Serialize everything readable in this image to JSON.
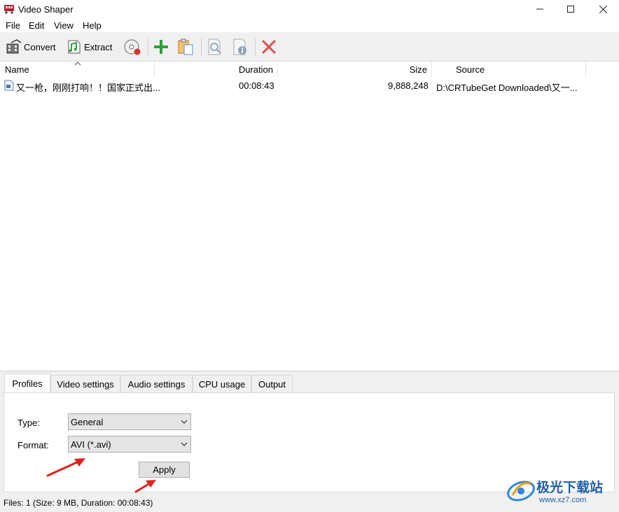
{
  "window": {
    "title": "Video Shaper",
    "minimize_icon": "minimize-icon",
    "maximize_icon": "maximize-icon",
    "close_icon": "close-icon"
  },
  "menu": [
    "File",
    "Edit",
    "View",
    "Help"
  ],
  "toolbar": {
    "convert_label": "Convert",
    "extract_label": "Extract"
  },
  "list": {
    "columns": {
      "name": "Name",
      "duration": "Duration",
      "size": "Size",
      "source": "Source"
    },
    "rows": [
      {
        "name": "又一枪，刚刚打响！！国家正式出...",
        "duration": "00:08:43",
        "size": "9,888,248",
        "source": "D:\\CRTubeGet Downloaded\\又一..."
      }
    ]
  },
  "tabs": [
    "Profiles",
    "Video settings",
    "Audio settings",
    "CPU usage",
    "Output"
  ],
  "profiles": {
    "type_label": "Type:",
    "type_value": "General",
    "format_label": "Format:",
    "format_value": "AVI (*.avi)",
    "apply_label": "Apply"
  },
  "status": {
    "text": "Files: 1 (Size: 9 MB, Duration: 00:08:43)"
  },
  "watermark": {
    "brand": "极光下载站",
    "url": "www.xz7.com"
  },
  "colors": {
    "annotation_arrow": "#e02020",
    "add_green": "#2e9e3e",
    "delete_red": "#d9534f"
  }
}
